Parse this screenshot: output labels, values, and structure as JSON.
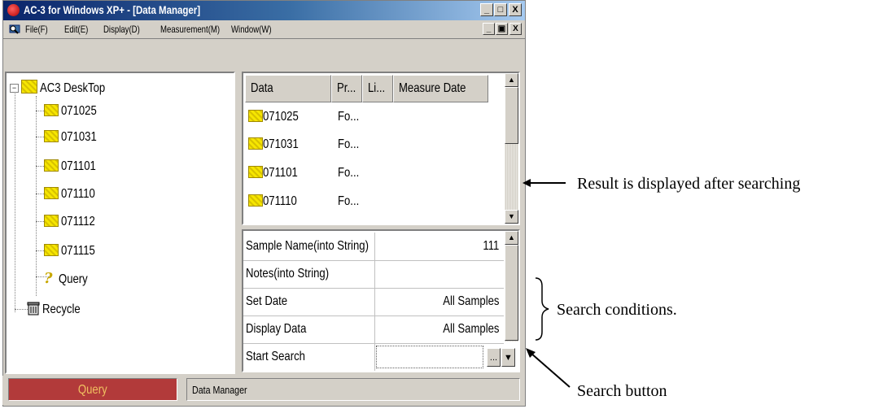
{
  "window": {
    "title": "AC-3 for Windows XP+ - [Data Manager]",
    "minimize": "_",
    "maximize": "□",
    "close": "X"
  },
  "menu": {
    "items": [
      "File(F)",
      "Edit(E)",
      "Display(D)",
      "Measurement(M)",
      "Window(W)"
    ],
    "mdi_minimize": "_",
    "mdi_restore": "▣",
    "mdi_close": "X"
  },
  "tree": {
    "root": "AC3 DeskTop",
    "folders": [
      "071025",
      "071031",
      "071101",
      "071110",
      "071112",
      "071115"
    ],
    "query": "Query",
    "recycle": "Recycle"
  },
  "results": {
    "columns": [
      "Data",
      "Pr...",
      "Li...",
      "Measure Date"
    ],
    "rows": [
      {
        "data": "071025",
        "pr": "Fo..."
      },
      {
        "data": "071031",
        "pr": "Fo..."
      },
      {
        "data": "071101",
        "pr": "Fo..."
      },
      {
        "data": "071110",
        "pr": "Fo..."
      }
    ]
  },
  "conditions": {
    "rows": [
      {
        "name": "Sample Name(into String)",
        "value": "111"
      },
      {
        "name": "Notes(into String)",
        "value": ""
      },
      {
        "name": "Set Date",
        "value": "All Samples"
      },
      {
        "name": "Display Data",
        "value": "All Samples"
      },
      {
        "name": "Start Search",
        "value": ""
      }
    ],
    "search_button": "..."
  },
  "status": {
    "mode": "Query",
    "panel": "Data Manager"
  },
  "annotations": {
    "result": "Result is displayed after searching",
    "conditions": "Search conditions.",
    "button": "Search button"
  },
  "colors": {
    "title_gradient_start": "#0a246a",
    "status_query_bg": "#b23a3a",
    "folder_yellow": "#f6e600"
  }
}
